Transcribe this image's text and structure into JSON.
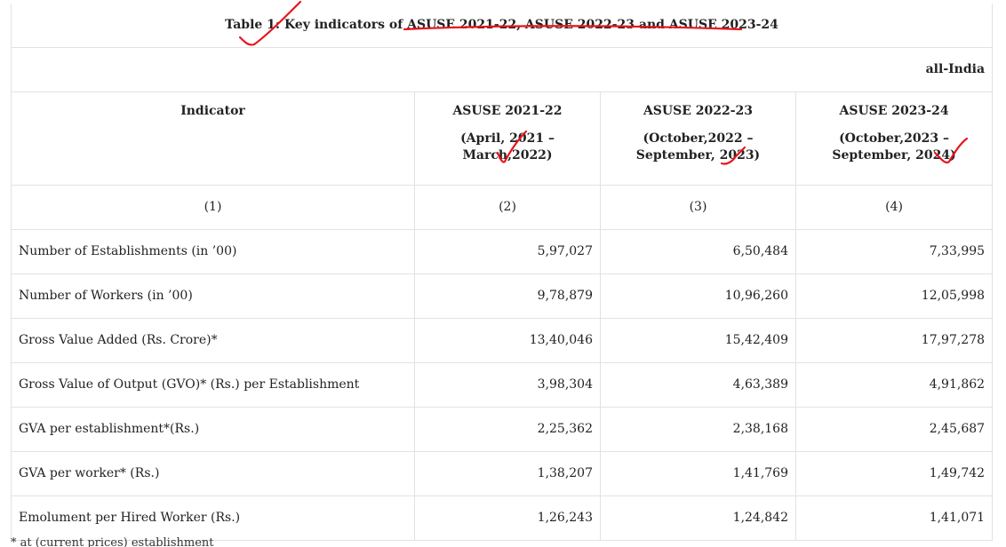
{
  "table": {
    "title": "Table 1: Key indicators of ASUSE 2021-22, ASUSE 2022-23 and ASUSE 2023-24",
    "region": "all-India",
    "headers": [
      {
        "label": "Indicator",
        "period": ""
      },
      {
        "label": "ASUSE 2021-22",
        "period": "(April, 2021 – March,2022)"
      },
      {
        "label": "ASUSE 2022-23",
        "period": "(October,2022 – September, 2023)"
      },
      {
        "label": "ASUSE 2023-24",
        "period": "(October,2023 – September, 2024)"
      }
    ],
    "col_numbers": [
      "(1)",
      "(2)",
      "(3)",
      "(4)"
    ],
    "rows": [
      {
        "indicator": "Number of Establishments (in ’00)",
        "v1": "5,97,027",
        "v2": "6,50,484",
        "v3": "7,33,995"
      },
      {
        "indicator": "Number of Workers (in ’00)",
        "v1": "9,78,879",
        "v2": "10,96,260",
        "v3": "12,05,998"
      },
      {
        "indicator": "Gross Value Added (Rs. Crore)*",
        "v1": "13,40,046",
        "v2": "15,42,409",
        "v3": "17,97,278"
      },
      {
        "indicator": "Gross Value of Output (GVO)* (Rs.) per Establishment",
        "v1": "3,98,304",
        "v2": "4,63,389",
        "v3": "4,91,862"
      },
      {
        "indicator": "GVA per establishment*(Rs.)",
        "v1": "2,25,362",
        "v2": "2,38,168",
        "v3": "2,45,687"
      },
      {
        "indicator": "GVA per worker* (Rs.)",
        "v1": "1,38,207",
        "v2": "1,41,769",
        "v3": "1,49,742"
      },
      {
        "indicator": "Emolument per Hired Worker (Rs.)",
        "v1": "1,26,243",
        "v2": "1,24,842",
        "v3": "1,41,071"
      }
    ],
    "footnote": "* at (current prices) establishment"
  },
  "colors": {
    "annotation": "#e8141c",
    "border": "#e2e2e2"
  }
}
